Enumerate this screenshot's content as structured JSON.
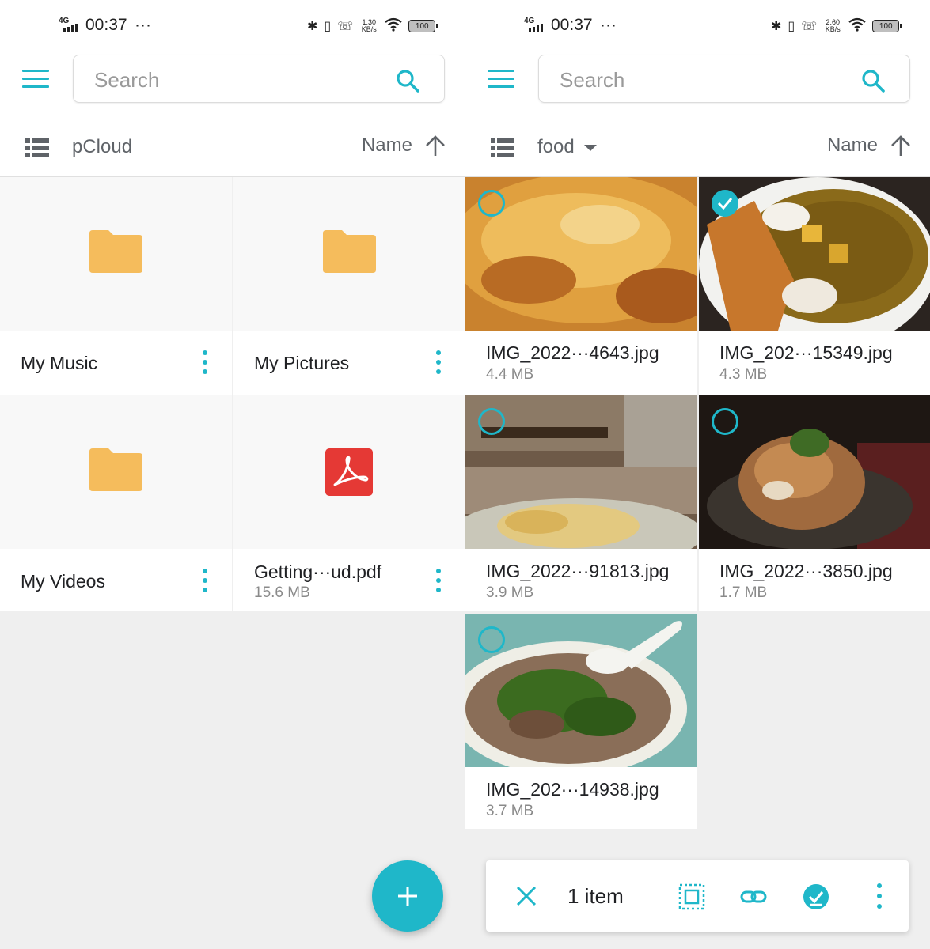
{
  "accent_color": "#1fb7c9",
  "left": {
    "status": {
      "network": "4G",
      "time": "00:37",
      "dots": "···",
      "speed_value": "1.30",
      "speed_unit": "KB/s",
      "battery": "100"
    },
    "search": {
      "placeholder": "Search"
    },
    "breadcrumb": "pCloud",
    "sort": {
      "label": "Name",
      "direction": "ascending"
    },
    "items": [
      {
        "name": "My Music",
        "type": "folder",
        "size": ""
      },
      {
        "name": "My Pictures",
        "type": "folder",
        "size": ""
      },
      {
        "name": "My Videos",
        "type": "folder",
        "size": ""
      },
      {
        "name": "Getting···ud.pdf",
        "type": "pdf",
        "size": "15.6 MB"
      }
    ],
    "fab": {
      "icon": "plus-icon"
    }
  },
  "right": {
    "status": {
      "network": "4G",
      "time": "00:37",
      "dots": "···",
      "speed_value": "2.60",
      "speed_unit": "KB/s",
      "battery": "100"
    },
    "search": {
      "placeholder": "Search"
    },
    "breadcrumb": "food",
    "sort": {
      "label": "Name",
      "direction": "ascending"
    },
    "items": [
      {
        "name": "IMG_2022···4643.jpg",
        "size": "4.4 MB",
        "selected": false
      },
      {
        "name": "IMG_202···15349.jpg",
        "size": "4.3 MB",
        "selected": true
      },
      {
        "name": "IMG_2022···91813.jpg",
        "size": "3.9 MB",
        "selected": false
      },
      {
        "name": "IMG_2022···3850.jpg",
        "size": "1.7 MB",
        "selected": false
      },
      {
        "name": "IMG_202···14938.jpg",
        "size": "3.7 MB",
        "selected": false
      }
    ],
    "selection_bar": {
      "count_label": "1 item",
      "actions": [
        "close-icon",
        "select-all-icon",
        "link-icon",
        "check-circle-icon",
        "more-icon"
      ]
    }
  }
}
